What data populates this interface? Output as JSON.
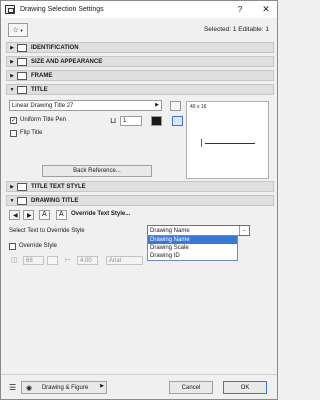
{
  "window": {
    "title": "Drawing Selection Settings",
    "help": "?",
    "close": "✕"
  },
  "toolbar": {
    "selection_info": "Selected: 1 Editable: 1"
  },
  "sections": {
    "identification": "IDENTIFICATION",
    "size_appearance": "SIZE AND APPEARANCE",
    "frame": "FRAME",
    "title": "TITLE",
    "title_text_style": "TITLE TEXT STYLE",
    "drawing_title": "DRAWING TITLE"
  },
  "title_panel": {
    "title_type": "Linear Drawing Title 27",
    "uniform_pen_label": "Uniform Title Pen",
    "uniform_pen_checked": true,
    "pen_value": "1",
    "flip_title_label": "Flip Title",
    "flip_title_checked": false,
    "preview_size": "40 x 16",
    "back_reference_label": "Back Reference..."
  },
  "drawing_title": {
    "override_text_style_label": "Override Text Style...",
    "select_text_label": "Select Text to Override Style",
    "select_value": "Drawing Name",
    "options": [
      "Drawing Name",
      "Drawing Scale",
      "Drawing ID"
    ],
    "override_style_label": "Override Style",
    "override_style_checked": false,
    "size_value": "66",
    "width_value": "4.00",
    "font_value": "Arial"
  },
  "footer": {
    "layer_label": "Drawing & Figure",
    "cancel_label": "Cancel",
    "ok_label": "OK"
  }
}
